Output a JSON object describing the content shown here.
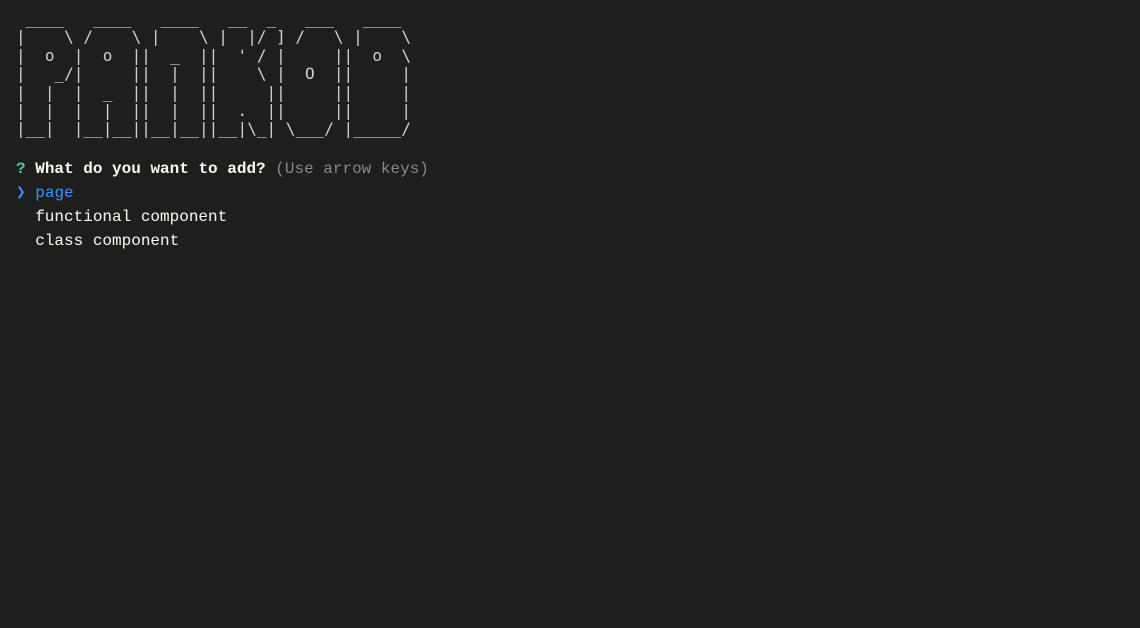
{
  "ascii_art": " ____   ____   ____   __  _   ___   ____  \n|    \\ /    \\ |    \\ |  |/ ] /   \\ |    \\ \n|  o  |  o  ||  _  ||  ' / |     ||  o  \\\n|   _/|     ||  |  ||    \\ |  O  ||     |\n|  |  |  _  ||  |  ||     ||     ||     |\n|  |  |  |  ||  |  ||  .  ||     ||     |\n|__|  |__|__||__|__||__|\\_| \\___/ |_____/",
  "prompt": {
    "question_mark": "?",
    "question": "What do you want to add?",
    "hint": "(Use arrow keys)"
  },
  "options": {
    "selected_pointer": "❯",
    "items": [
      {
        "label": "page",
        "selected": true
      },
      {
        "label": "functional component",
        "selected": false
      },
      {
        "label": "class component",
        "selected": false
      }
    ]
  }
}
